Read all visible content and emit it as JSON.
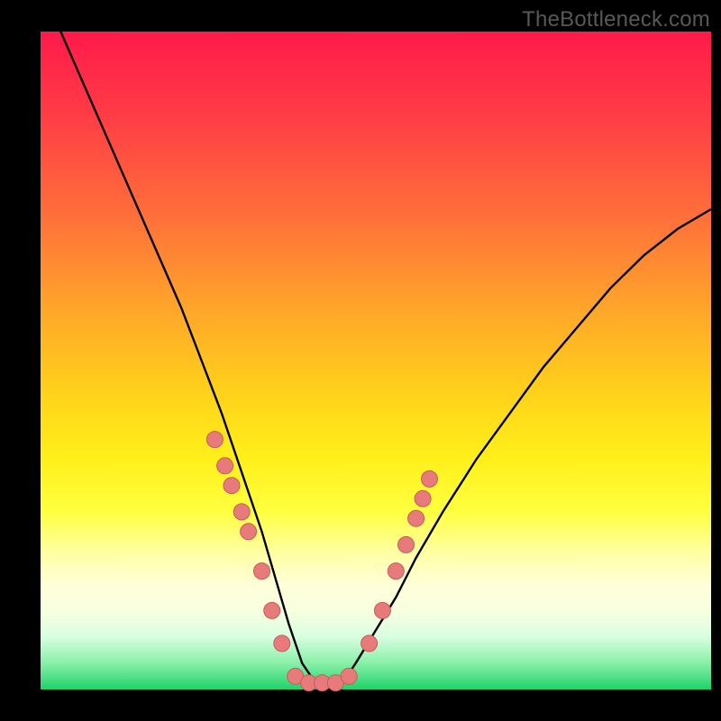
{
  "watermark": "TheBottleneck.com",
  "colors": {
    "curve": "#000000",
    "dot_fill": "#e77a7a",
    "dot_stroke": "#c95b5b",
    "background_black": "#000000"
  },
  "chart_data": {
    "type": "line",
    "title": "",
    "xlabel": "",
    "ylabel": "",
    "xlim": [
      0,
      100
    ],
    "ylim": [
      0,
      100
    ],
    "grid": false,
    "legend": false,
    "note": "Bottleneck-style V curve; y-axis is inverted visually (0 at bottom = best/green, 100 at top = worst/red). Minimum of curve sits near x≈40 at y≈0. Pink dots mark discrete hardware samples along both arms near the trough.",
    "series": [
      {
        "name": "bottleneck_curve",
        "x": [
          3,
          6,
          9,
          12,
          15,
          18,
          21,
          24,
          27,
          30,
          33,
          35,
          37,
          39,
          41,
          43,
          45,
          47,
          50,
          53,
          56,
          60,
          65,
          70,
          75,
          80,
          85,
          90,
          95,
          100
        ],
        "y": [
          100,
          93,
          86,
          79,
          72,
          65,
          58,
          50,
          42,
          33,
          24,
          17,
          10,
          4,
          1,
          0,
          1,
          4,
          9,
          14,
          20,
          27,
          35,
          42,
          49,
          55,
          61,
          66,
          70,
          73
        ]
      }
    ],
    "dots": {
      "left_arm": [
        {
          "x": 26,
          "y": 38
        },
        {
          "x": 27.5,
          "y": 34
        },
        {
          "x": 28.5,
          "y": 31
        },
        {
          "x": 30,
          "y": 27
        },
        {
          "x": 31,
          "y": 24
        },
        {
          "x": 33,
          "y": 18
        },
        {
          "x": 34.5,
          "y": 12
        },
        {
          "x": 36,
          "y": 7
        }
      ],
      "trough": [
        {
          "x": 38,
          "y": 2
        },
        {
          "x": 40,
          "y": 1
        },
        {
          "x": 42,
          "y": 1
        },
        {
          "x": 44,
          "y": 1
        },
        {
          "x": 46,
          "y": 2
        }
      ],
      "right_arm": [
        {
          "x": 49,
          "y": 7
        },
        {
          "x": 51,
          "y": 12
        },
        {
          "x": 53,
          "y": 18
        },
        {
          "x": 54.5,
          "y": 22
        },
        {
          "x": 56,
          "y": 26
        },
        {
          "x": 57,
          "y": 29
        },
        {
          "x": 58,
          "y": 32
        }
      ]
    }
  }
}
